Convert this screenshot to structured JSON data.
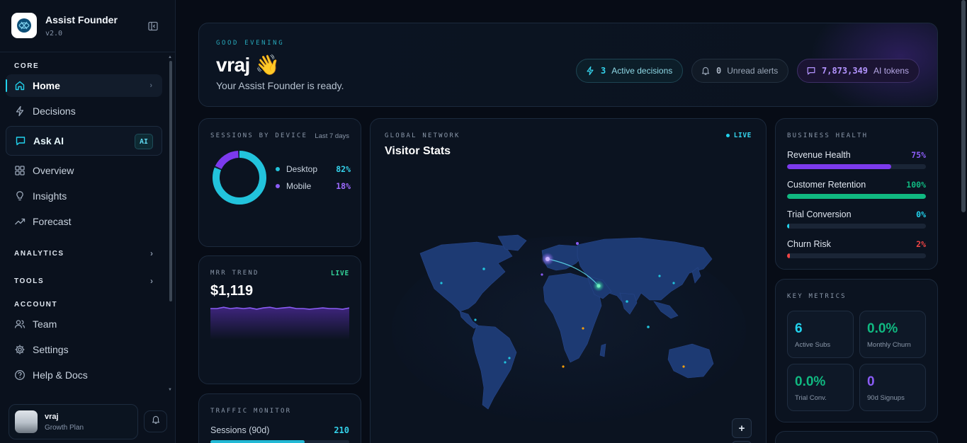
{
  "app": {
    "title": "Assist Founder",
    "version": "v2.0"
  },
  "sidebar": {
    "core_label": "CORE",
    "items": [
      {
        "label": "Home",
        "icon": "home-icon"
      },
      {
        "label": "Decisions",
        "icon": "bolt-icon"
      },
      {
        "label": "Ask AI",
        "icon": "chat-icon",
        "badge": "AI"
      },
      {
        "label": "Overview",
        "icon": "grid-icon"
      },
      {
        "label": "Insights",
        "icon": "lightbulb-icon"
      },
      {
        "label": "Forecast",
        "icon": "trend-icon"
      }
    ],
    "analytics_label": "ANALYTICS",
    "tools_label": "TOOLS",
    "account_label": "ACCOUNT",
    "account_items": [
      {
        "label": "Team",
        "icon": "users-icon"
      },
      {
        "label": "Settings",
        "icon": "gear-icon"
      },
      {
        "label": "Help & Docs",
        "icon": "help-icon"
      }
    ],
    "user": {
      "name": "vraj",
      "plan": "Growth Plan"
    }
  },
  "hero": {
    "greeting": "GOOD EVENING",
    "name": "vraj 👋",
    "subtitle": "Your Assist Founder is ready.",
    "pills": [
      {
        "value": "3",
        "label": "Active decisions"
      },
      {
        "value": "0",
        "label": "Unread alerts"
      },
      {
        "value": "7,873,349",
        "label": "AI tokens"
      }
    ]
  },
  "sessions": {
    "title": "SESSIONS BY DEVICE",
    "range": "Last 7 days",
    "chart_data": {
      "type": "pie",
      "categories": [
        "Desktop",
        "Mobile"
      ],
      "values": [
        82,
        18
      ],
      "labels": [
        "82%",
        "18%"
      ],
      "colors": [
        "#22c3dc",
        "#7c3aed"
      ]
    }
  },
  "mrr": {
    "title": "MRR TREND",
    "live": "LIVE",
    "value": "$1,119",
    "chart_data": {
      "type": "area",
      "values": [
        20,
        20,
        22,
        20,
        21,
        20,
        21,
        19,
        21,
        22,
        20,
        21,
        22,
        20,
        20,
        19,
        20,
        21,
        20,
        20,
        19,
        21
      ]
    }
  },
  "traffic": {
    "title": "TRAFFIC MONITOR",
    "row_label": "Sessions (90d)",
    "row_value": "210",
    "progress": 0.68
  },
  "map": {
    "label": "GLOBAL NETWORK",
    "title": "Visitor Stats",
    "live": "LIVE",
    "zoom_in": "+"
  },
  "health": {
    "title": "BUSINESS HEALTH",
    "rows": [
      {
        "label": "Revenue Health",
        "value": "75%",
        "fraction": 0.75,
        "color": "#7c3aed"
      },
      {
        "label": "Customer Retention",
        "value": "100%",
        "fraction": 1.0,
        "color": "#10b981"
      },
      {
        "label": "Trial Conversion",
        "value": "0%",
        "fraction": 0.0,
        "color": "#22d3ee"
      },
      {
        "label": "Churn Risk",
        "value": "2%",
        "fraction": 0.02,
        "color": "#ef4444"
      }
    ]
  },
  "metrics": {
    "title": "KEY METRICS",
    "tiles": [
      {
        "value": "6",
        "label": "Active Subs",
        "color": "#22d3ee"
      },
      {
        "value": "0.0%",
        "label": "Monthly Churn",
        "color": "#10b981"
      },
      {
        "value": "0.0%",
        "label": "Trial Conv.",
        "color": "#10b981"
      },
      {
        "value": "0",
        "label": "90d Signups",
        "color": "#8b5cf6"
      }
    ]
  }
}
